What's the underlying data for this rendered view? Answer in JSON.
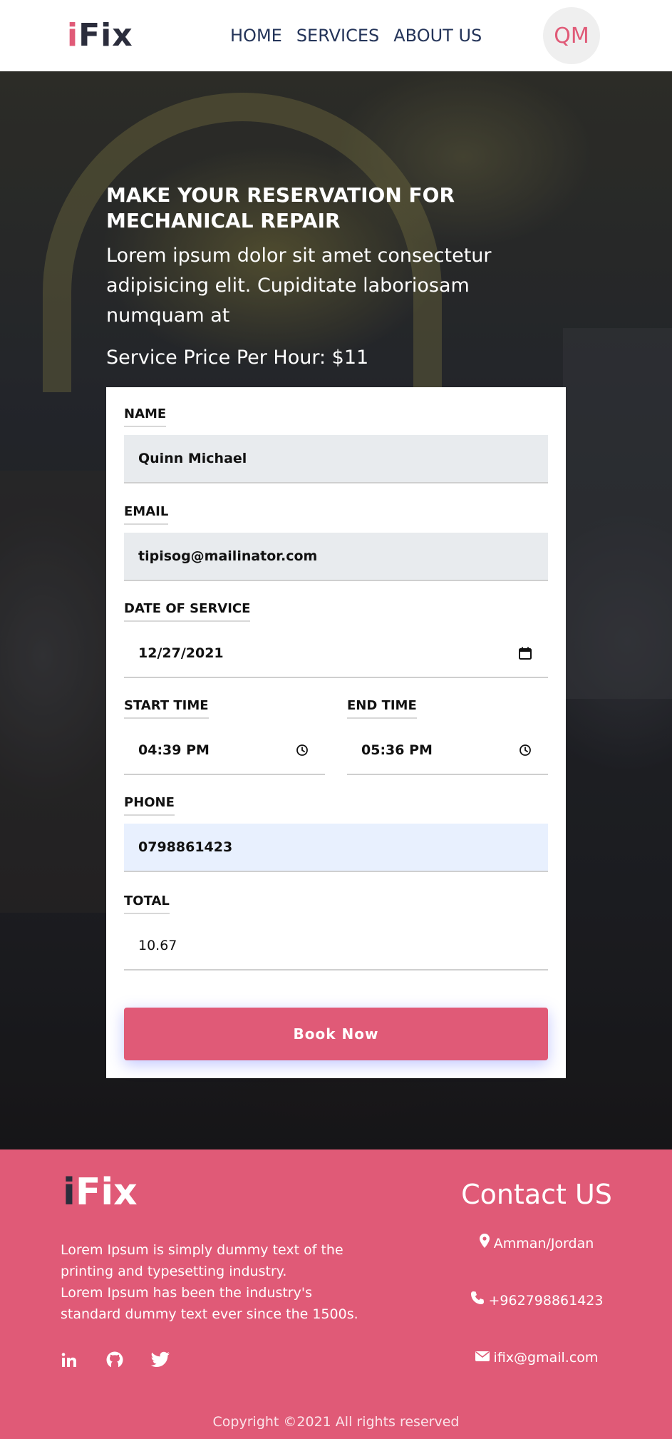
{
  "header": {
    "logo": {
      "i": "i",
      "rest": "Fix"
    },
    "nav": [
      "HOME",
      "SERVICES",
      "ABOUT US"
    ],
    "avatar_initials": "QM"
  },
  "hero": {
    "title": "MAKE YOUR RESERVATION FOR MECHANICAL REPAIR",
    "text": "Lorem ipsum dolor sit amet consectetur adipisicing elit. Cupiditate laboriosam numquam at",
    "price": "Service Price Per Hour: $11"
  },
  "form": {
    "name_label": "NAME",
    "name_value": "Quinn Michael",
    "email_label": "EMAIL",
    "email_value": "tipisog@mailinator.com",
    "date_label": "DATE OF SERVICE",
    "date_value": "12/27/2021",
    "start_label": "START TIME",
    "start_value": "04:39 PM",
    "end_label": "END TIME",
    "end_value": "05:36 PM",
    "phone_label": "PHONE",
    "phone_value": "0798861423",
    "total_label": "TOTAL",
    "total_value": "10.67",
    "submit_label": "Book Now"
  },
  "footer": {
    "logo": {
      "i": "i",
      "rest": "Fix"
    },
    "text_line1": "Lorem Ipsum is simply dummy text of the printing and typesetting industry.",
    "text_line2": "Lorem Ipsum has been the industry's standard dummy text ever since the 1500s.",
    "social_icons": [
      "linkedin-icon",
      "github-icon",
      "twitter-icon"
    ],
    "contact_title": "Contact US",
    "location": "Amman/Jordan",
    "phone": "+962798861423",
    "email": "ifix@gmail.com",
    "copyright": "Copyright ©2021 All rights reserved"
  },
  "colors": {
    "accent": "#e05a77",
    "nav_text": "#243459",
    "input_grey": "#e8ebee",
    "input_blue": "#e8f0fe"
  }
}
